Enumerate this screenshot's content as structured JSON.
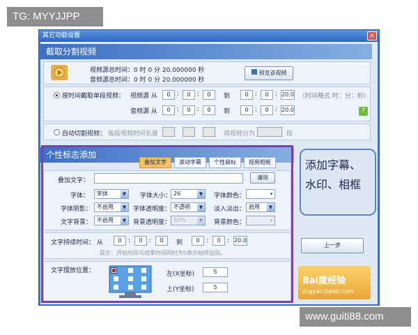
{
  "watermark_top": "TG: MYYJJPP",
  "watermark_bottom": "www.guiti88.com",
  "window": {
    "title": "其它功能设置",
    "close": "×"
  },
  "cut_section": {
    "header": "截取分割视频",
    "video_total": "视频源总时间：0    时  0    分 20.000000 秒",
    "audio_total": "音频源总时间：0    时  0    分 20.000000 秒",
    "preview_btn": "预览该视频",
    "radio_time": "按时间截取单段视频：",
    "video_src": "视频源  从",
    "audio_src": "音频源  从",
    "to": "到",
    "colon": ":",
    "zero": "0",
    "twenty": "20.0",
    "time_format": "（时间格式 时：分：秒）",
    "radio_auto": "自动切割视频：",
    "auto_desc": "每段视频时间长度",
    "split_into": "将视频分为",
    "segments": "段"
  },
  "logo_section": {
    "header": "个性标志添加",
    "tabs": [
      "叠加文字",
      "滚动字幕",
      "个性商标",
      "视频相框"
    ],
    "overlay_label": "叠加文字：",
    "clear_btn": "清除",
    "font_label": "字体：",
    "font_value": "宋体",
    "font_size_label": "字体大小：",
    "font_size_value": "26",
    "font_color_label": "字体颜色：",
    "shadow_label": "字体阴影：",
    "shadow_value": "不启用",
    "opacity_label": "字体透明度：",
    "opacity_value": "不透明",
    "fade_label": "淡入淡出：",
    "fade_value": "启用",
    "bg_label": "文字背景：",
    "bg_value": "不启用",
    "bg_opacity_label": "背景透明度：",
    "bg_opacity_value": "50%",
    "bg_color_label": "背景颜色：",
    "duration_label": "文字持续时间：  从",
    "to": "到",
    "colon": ":",
    "zero": "0",
    "twenty": "20.0",
    "hint": "提示：开始时间与结束时间同时为0表示始终出现。",
    "position_label": "文字摆放位置：",
    "left_x": "左(X坐标)",
    "left_x_value": "5",
    "top_y": "上(Y坐标)",
    "top_y_value": "5"
  },
  "right_panel": {
    "prev_btn": "上一步",
    "baidu_logo": "Bai度经验",
    "baidu_url": "jingyan.baidu.com"
  },
  "callout": {
    "line1": "添加字幕、",
    "line2": "水印、相框"
  }
}
